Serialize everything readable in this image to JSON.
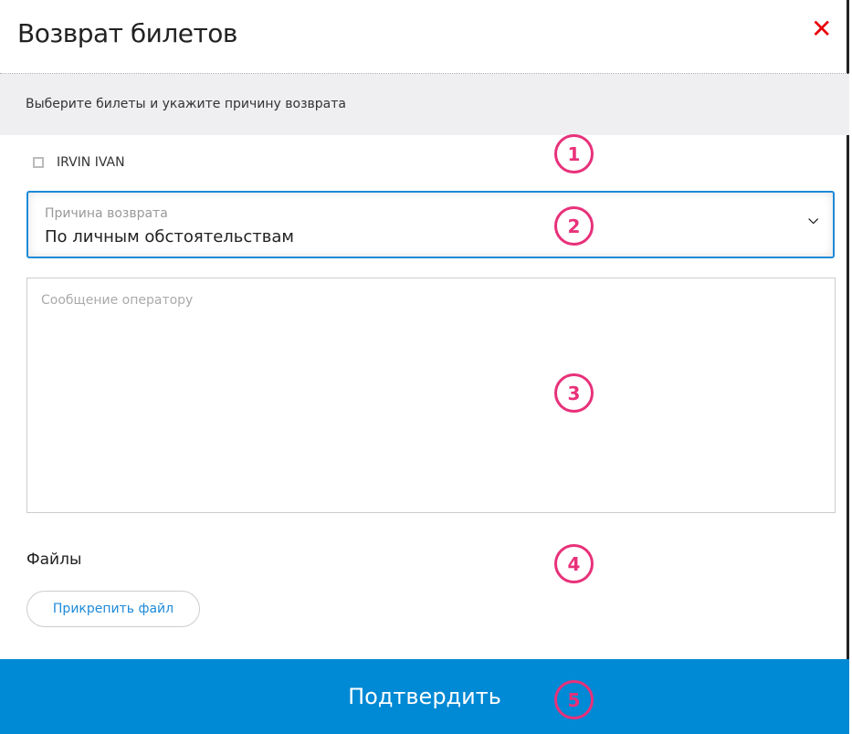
{
  "dialog": {
    "title": "Возврат билетов",
    "close_icon": "close-icon"
  },
  "instruction": "Выберите билеты и укажите причину возврата",
  "passengers": [
    {
      "name": "IRVIN IVAN",
      "checked": false
    }
  ],
  "reason": {
    "label": "Причина возврата",
    "value": "По личным обстоятельствам"
  },
  "message": {
    "placeholder": "Сообщение оператору",
    "value": ""
  },
  "files": {
    "heading": "Файлы",
    "attach_label": "Прикрепить файл"
  },
  "confirm_label": "Подтвердить",
  "markers": [
    "1",
    "2",
    "3",
    "4",
    "5"
  ],
  "colors": {
    "accent": "#0089d4",
    "close": "#e8000b",
    "marker": "#e8317a"
  }
}
